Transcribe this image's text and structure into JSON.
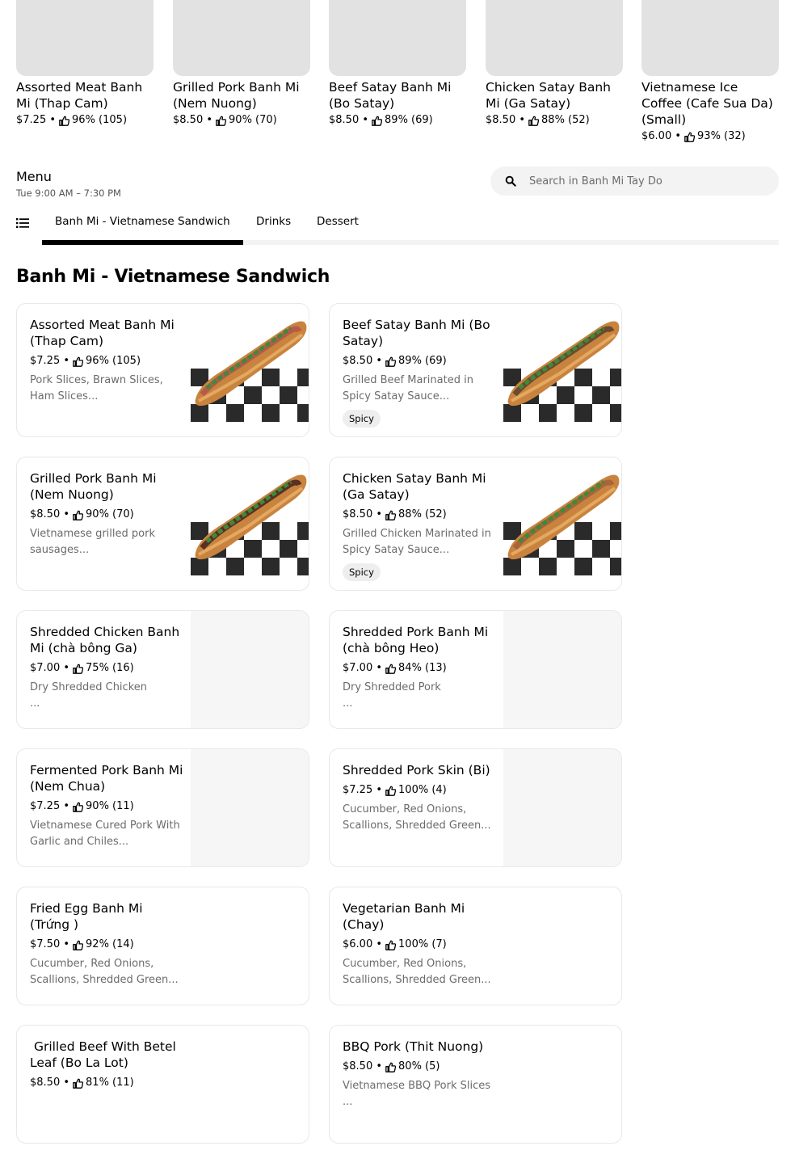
{
  "carousel": [
    {
      "title": "Assorted Meat Banh Mi (Thap Cam)",
      "price": "$7.25 •",
      "rating": "96% (105)"
    },
    {
      "title": "Grilled Pork Banh Mi (Nem Nuong)",
      "price": "$8.50 •",
      "rating": "90% (70)"
    },
    {
      "title": "Beef Satay Banh Mi (Bo Satay)",
      "price": "$8.50 •",
      "rating": "89% (69)"
    },
    {
      "title": "Chicken Satay Banh Mi (Ga Satay)",
      "price": "$8.50 •",
      "rating": "88% (52)"
    },
    {
      "title": "Vietnamese Ice Coffee (Cafe Sua Da) (Small)",
      "price": "$6.00 •",
      "rating": "93% (32)"
    }
  ],
  "menu": {
    "title": "Menu",
    "hours": "Tue 9:00 AM – 7:30 PM"
  },
  "search": {
    "placeholder": "Search in Banh Mi Tay Do",
    "icon": "search-icon"
  },
  "tabs": [
    {
      "label": "Banh Mi - Vietnamese Sandwich",
      "active": true
    },
    {
      "label": "Drinks",
      "active": false
    },
    {
      "label": "Dessert",
      "active": false
    }
  ],
  "section": {
    "title": "Banh Mi - Vietnamese Sandwich"
  },
  "items": [
    {
      "title": "Assorted Meat Banh Mi (Thap Cam)",
      "price": "$7.25 •",
      "rating": "96% (105)",
      "desc1": "Pork Slices, Brawn Slices,",
      "desc2": "Ham Slices...",
      "tag": ""
    },
    {
      "title": "Beef Satay Banh Mi (Bo Satay)",
      "price": "$8.50 •",
      "rating": "89% (69)",
      "desc1": "Grilled Beef Marinated in",
      "desc2": "Spicy Satay Sauce...",
      "tag": "Spicy"
    },
    {
      "title": "Grilled Pork Banh Mi (Nem Nuong)",
      "price": "$8.50 •",
      "rating": "90% (70)",
      "desc1": "Vietnamese grilled pork",
      "desc2": "sausages...",
      "tag": ""
    },
    {
      "title": "Chicken Satay Banh Mi (Ga Satay)",
      "price": "$8.50 •",
      "rating": "88% (52)",
      "desc1": "Grilled Chicken Marinated in",
      "desc2": "Spicy Satay Sauce...",
      "tag": "Spicy"
    },
    {
      "title": "Shredded Chicken Banh Mi (chà bông Ga)",
      "price": "$7.00 •",
      "rating": "75% (16)",
      "desc1": "Dry Shredded Chicken",
      "desc2": "...",
      "tag": ""
    },
    {
      "title": "Shredded Pork Banh Mi (chà bông Heo)",
      "price": "$7.00 •",
      "rating": "84% (13)",
      "desc1": "Dry Shredded Pork",
      "desc2": "...",
      "tag": ""
    },
    {
      "title": "Fermented Pork Banh Mi (Nem Chua)",
      "price": "$7.25 •",
      "rating": "90% (11)",
      "desc1": "Vietnamese Cured Pork With",
      "desc2": "Garlic and Chiles...",
      "tag": ""
    },
    {
      "title": "Shredded Pork Skin (Bi)",
      "price": "$7.25 •",
      "rating": "100% (4)",
      "desc1": "Cucumber, Red Onions,",
      "desc2": "Scallions, Shredded Green...",
      "tag": ""
    },
    {
      "title": "Fried Egg Banh Mi (Trứng )",
      "price": "$7.50 •",
      "rating": "92% (14)",
      "desc1": "Cucumber, Red Onions,",
      "desc2": "Scallions, Shredded Green...",
      "tag": ""
    },
    {
      "title": "Vegetarian Banh Mi (Chay)",
      "price": "$6.00 •",
      "rating": "100% (7)",
      "desc1": "Cucumber, Red Onions,",
      "desc2": "Scallions, Shredded Green...",
      "tag": ""
    },
    {
      "title": " Grilled Beef With Betel Leaf (Bo La Lot)",
      "price": "$8.50 •",
      "rating": "81% (11)",
      "desc1": "",
      "desc2": "",
      "tag": ""
    },
    {
      "title": "BBQ Pork (Thit Nuong)",
      "price": "$8.50 •",
      "rating": "80% (5)",
      "desc1": "Vietnamese BBQ Pork Slices",
      "desc2": "...",
      "tag": ""
    }
  ]
}
